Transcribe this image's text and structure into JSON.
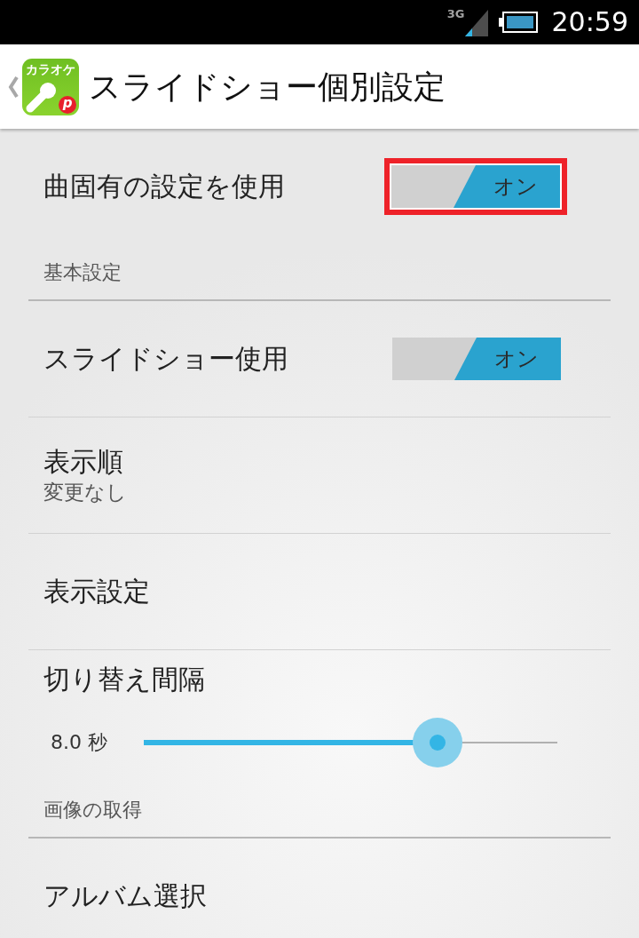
{
  "status_bar": {
    "network": "3G",
    "time": "20:59"
  },
  "action_bar": {
    "logo_text": "カラオケ",
    "logo_badge": "p",
    "title": "スライドショー個別設定"
  },
  "items": [
    {
      "kind": "switch",
      "title": "曲固有の設定を使用",
      "switch_label": "オン",
      "on": true,
      "highlighted": true
    },
    {
      "kind": "category",
      "title": "基本設定"
    },
    {
      "kind": "switch",
      "title": "スライドショー使用",
      "switch_label": "オン",
      "on": true,
      "highlighted": false
    },
    {
      "kind": "list",
      "title": "表示順",
      "summary": "変更なし"
    },
    {
      "kind": "plain",
      "title": "表示設定"
    },
    {
      "kind": "slider",
      "title": "切り替え間隔",
      "reading": "8.0 秒",
      "level": 0.71
    },
    {
      "kind": "category",
      "title": "画像の取得"
    },
    {
      "kind": "plain",
      "title": "アルバム選択"
    }
  ]
}
